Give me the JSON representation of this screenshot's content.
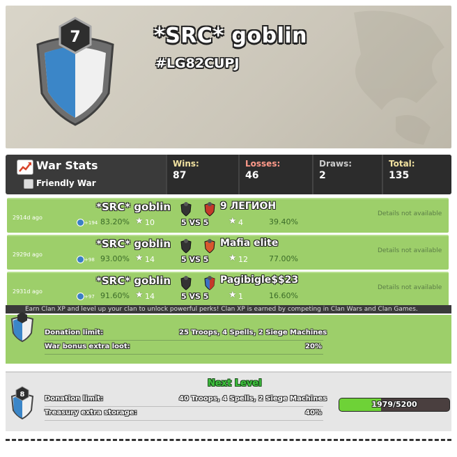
{
  "clan": {
    "name": "*SRC* goblin",
    "tag": "#LG82CUPJ",
    "level": "7"
  },
  "war_stats": {
    "title": "War Stats",
    "friendly_war_label": "Friendly War",
    "wins_label": "Wins:",
    "wins": "87",
    "losses_label": "Losses:",
    "losses": "46",
    "draws_label": "Draws:",
    "draws": "2",
    "total_label": "Total:",
    "total": "135"
  },
  "wars": [
    {
      "ago": "2914d ago",
      "clan": "*SRC* goblin",
      "xp": "+194",
      "pct": "83.20%",
      "stars": "10",
      "size": "5 VS 5",
      "opponent": "9 ЛЕГИОН",
      "opp_stars": "4",
      "opp_pct": "39.40%",
      "details": "Details not available"
    },
    {
      "ago": "2929d ago",
      "clan": "*SRC* goblin",
      "xp": "+98",
      "pct": "93.00%",
      "stars": "14",
      "size": "5 VS 5",
      "opponent": "Mafia elite",
      "opp_stars": "12",
      "opp_pct": "77.00%",
      "details": "Details not available"
    },
    {
      "ago": "2931d ago",
      "clan": "*SRC* goblin",
      "xp": "+97",
      "pct": "91.60%",
      "stars": "14",
      "size": "5 VS 5",
      "opponent": "Pagibigle$$23",
      "opp_stars": "1",
      "opp_pct": "16.60%",
      "details": "Details not available"
    }
  ],
  "perks": {
    "intro": "Earn Clan XP and level up your clan to unlock powerful perks! Clan XP is earned by competing in Clan Wars and Clan Games.",
    "current": {
      "level": "7",
      "donation_label": "Donation limit:",
      "donation_value": "25 Troops, 4 Spells, 2 Siege Machines",
      "bonus_label": "War bonus extra loot:",
      "bonus_value": "20%"
    },
    "next": {
      "title": "Next Level",
      "level": "8",
      "donation_label": "Donation limit:",
      "donation_value": "40 Troops, 4 Spells, 2 Siege Machines",
      "storage_label": "Treasury extra storage:",
      "storage_value": "40%",
      "xp": "1979/5200",
      "xp_fraction": 0.3806
    }
  },
  "colors": {
    "row_green": "#9dcf6a",
    "wins": "#f2e2a0",
    "losses": "#ff9a8a",
    "draws": "#cccccc",
    "total": "#f2e2a0"
  }
}
